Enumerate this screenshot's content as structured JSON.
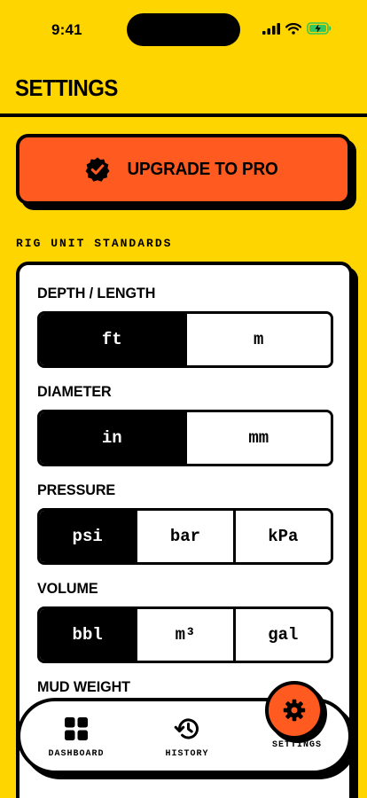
{
  "status_bar": {
    "time": "9:41",
    "icons": [
      "signal-icon",
      "wifi-icon",
      "battery-charging-icon"
    ]
  },
  "header": {
    "title": "SETTINGS"
  },
  "upgrade": {
    "label": "UPGRADE TO PRO",
    "icon": "verified-badge-icon"
  },
  "section": {
    "label": "RIG UNIT STANDARDS"
  },
  "groups": [
    {
      "title": "DEPTH / LENGTH",
      "options": [
        "ft",
        "m"
      ],
      "selected": 0
    },
    {
      "title": "DIAMETER",
      "options": [
        "in",
        "mm"
      ],
      "selected": 0
    },
    {
      "title": "PRESSURE",
      "options": [
        "psi",
        "bar",
        "kPa"
      ],
      "selected": 0
    },
    {
      "title": "VOLUME",
      "options": [
        "bbl",
        "m³",
        "gal"
      ],
      "selected": 0
    },
    {
      "title": "MUD WEIGHT",
      "options": [],
      "selected": null
    }
  ],
  "nav": {
    "items": [
      {
        "label": "DASHBOARD",
        "icon": "grid-icon"
      },
      {
        "label": "HISTORY",
        "icon": "history-icon"
      },
      {
        "label": "SETTINGS",
        "icon": "gear-icon",
        "active": true
      }
    ]
  },
  "colors": {
    "background": "#FFD500",
    "accent": "#FF5A1F",
    "ink": "#000000",
    "card": "#FFFFFF"
  }
}
